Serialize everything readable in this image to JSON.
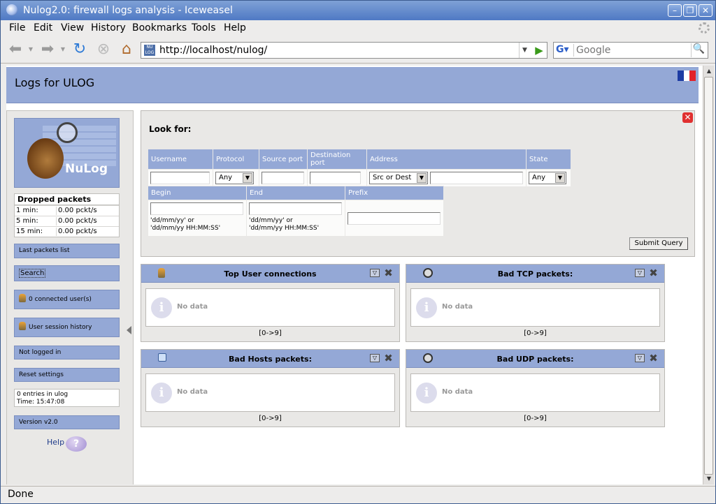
{
  "window": {
    "title": "Nulog2.0: firewall logs analysis - Iceweasel"
  },
  "menu": {
    "file": "File",
    "edit": "Edit",
    "view": "View",
    "history": "History",
    "bookmarks": "Bookmarks",
    "tools": "Tools",
    "help": "Help"
  },
  "nav": {
    "url": "http://localhost/nulog/",
    "search_placeholder": "Google",
    "favicon_text": "NU LOG"
  },
  "status": "Done",
  "page": {
    "title": "Logs for ULOG",
    "logo_text": "NuLog",
    "dropped": {
      "heading": "Dropped packets",
      "rows": [
        {
          "label": "1 min:",
          "value": "0.00 pckt/s"
        },
        {
          "label": "5 min:",
          "value": "0.00 pckt/s"
        },
        {
          "label": "15 min:",
          "value": "0.00 pckt/s"
        }
      ]
    },
    "sidebar": {
      "last_packets": "Last packets list",
      "search": "Search",
      "connected_users": "0 connected user(s)",
      "session_history": "User session history",
      "not_logged": "Not logged in",
      "reset": "Reset settings",
      "entries": "0 entries in ulog",
      "time": "Time: 15:47:08",
      "version": "Version v2.0",
      "help": "Help"
    },
    "search_form": {
      "heading": "Look for:",
      "username": "Username",
      "protocol": "Protocol",
      "protocol_value": "Any",
      "source_port": "Source port",
      "dest_port": "Destination port",
      "address": "Address",
      "address_value": "Src or Dest",
      "state": "State",
      "state_value": "Any",
      "begin": "Begin",
      "end": "End",
      "prefix": "Prefix",
      "date_hint1": "'dd/mm/yy' or",
      "date_hint2": "'dd/mm/yy HH:MM:SS'",
      "submit": "Submit Query"
    },
    "widgets": [
      {
        "title": "Top User connections",
        "icon": "user-icon",
        "empty": "No data",
        "range": "[0->9]"
      },
      {
        "title": "Bad TCP packets:",
        "icon": "gear-icon",
        "empty": "No data",
        "range": "[0->9]"
      },
      {
        "title": "Bad Hosts packets:",
        "icon": "network-icon",
        "empty": "No data",
        "range": "[0->9]"
      },
      {
        "title": "Bad UDP packets:",
        "icon": "gear-icon",
        "empty": "No data",
        "range": "[0->9]"
      }
    ]
  },
  "colors": {
    "accent": "#94a8d6",
    "titlebar": "#4f79c4",
    "close": "#e03030"
  }
}
